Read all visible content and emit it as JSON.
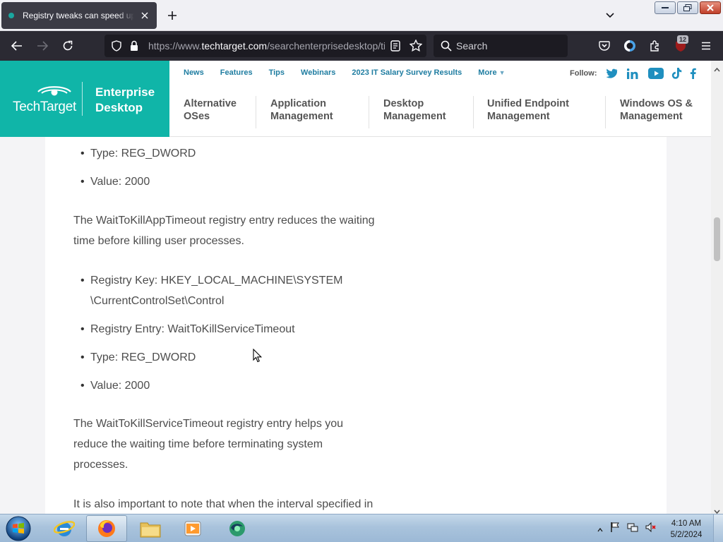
{
  "browser": {
    "tab_title": "Registry tweaks can speed up Windows",
    "url_prefix": "https://www.",
    "url_host": "techtarget.com",
    "url_path": "/searchenterprisedesktop/tip/",
    "search_placeholder": "Search",
    "extension_badge": "12"
  },
  "site": {
    "logo_text": "TechTarget",
    "section_line1": "Enterprise",
    "section_line2": "Desktop",
    "top_nav": [
      "News",
      "Features",
      "Tips",
      "Webinars",
      "2023 IT Salary Survey Results",
      "More"
    ],
    "follow_label": "Follow:",
    "categories": [
      {
        "line1": "Alternative",
        "line2": "OSes"
      },
      {
        "line1": "Application",
        "line2": "Management"
      },
      {
        "line1": "Desktop",
        "line2": "Management"
      },
      {
        "line1": "Unified Endpoint",
        "line2": "Management"
      },
      {
        "line1": "Windows OS &",
        "line2": "Management"
      }
    ]
  },
  "article": {
    "b1": "Type: REG_DWORD",
    "b2": "Value: 2000",
    "p1_l1": "The WaitToKillAppTimeout registry entry reduces the waiting",
    "p1_l2": "time before killing user processes.",
    "b3_l1": "Registry Key: HKEY_LOCAL_MACHINE\\SYSTEM",
    "b3_l2": "\\CurrentControlSet\\Control",
    "b4": "Registry Entry: WaitToKillServiceTimeout",
    "b5": "Type: REG_DWORD",
    "b6": "Value: 2000",
    "p2_l1": "The WaitToKillServiceTimeout registry entry helps you",
    "p2_l2": "reduce the waiting time before terminating system",
    "p2_l3": "processes.",
    "p3_l1": "It is also important to note that when the interval specified in"
  },
  "taskbar": {
    "time": "4:10 AM",
    "date": "5/2/2024"
  },
  "colors": {
    "brand_teal": "#10b5a8",
    "link_blue": "#1f7da1",
    "firefox_toolbar": "#2b2a33"
  }
}
